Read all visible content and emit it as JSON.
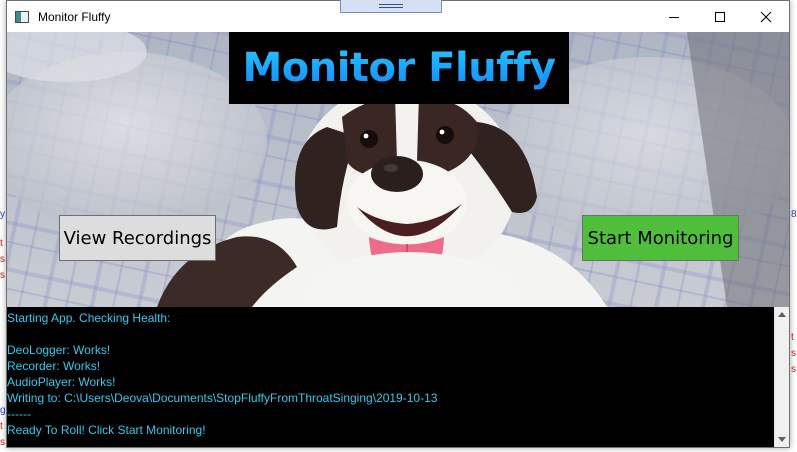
{
  "window": {
    "title": "Monitor Fluffy"
  },
  "header": {
    "headline": "Monitor Fluffy"
  },
  "buttons": {
    "view_recordings": "View Recordings",
    "start_monitoring": "Start Monitoring"
  },
  "log": {
    "lines": [
      "Starting App. Checking Health:",
      "",
      "DeoLogger: Works!",
      "Recorder: Works!",
      "AudioPlayer: Works!",
      "Writing to: C:\\Users\\Deova\\Documents\\StopFluffyFromThroatSinging\\2019-10-13",
      "------",
      "Ready To Roll! Click Start Monitoring!"
    ]
  },
  "background_fragments": {
    "left": [
      "y",
      "t",
      "s",
      "s",
      "g",
      "t",
      "s"
    ],
    "right": [
      "8",
      "t",
      "s",
      "s"
    ]
  },
  "colors": {
    "headline_gradient": "#1aa3ff",
    "start_button": "#4fbe3a",
    "view_button": "#dddddd",
    "log_text": "#35c8ee",
    "log_background": "#000000"
  },
  "icons": [
    "app-window-icon",
    "minimize-icon",
    "maximize-icon",
    "close-icon",
    "dog-photo"
  ]
}
